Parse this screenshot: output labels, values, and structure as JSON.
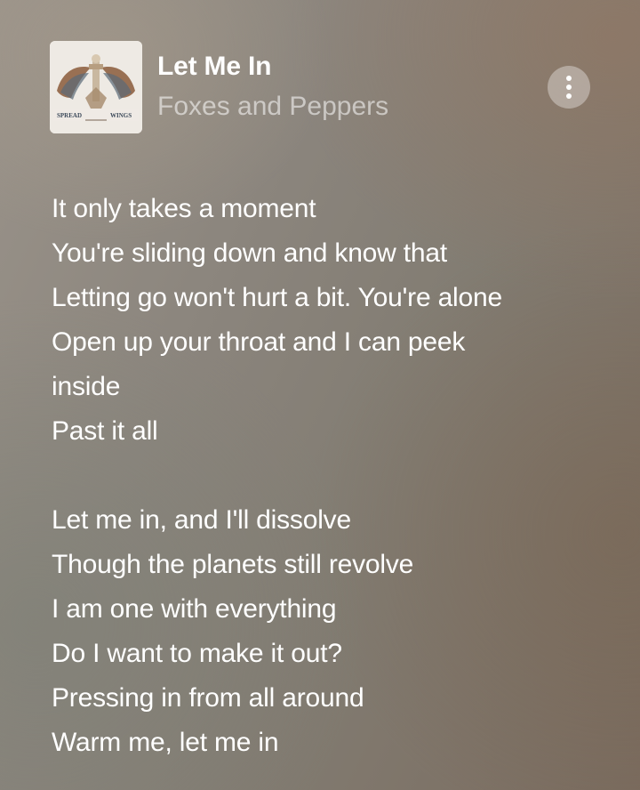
{
  "track": {
    "title": "Let Me In",
    "artist": "Foxes and Peppers",
    "album_art": {
      "icon": "album-cover-spread-the-wings",
      "text_left": "SPREAD",
      "text_right": "WINGS"
    }
  },
  "more_button": {
    "icon": "more-vertical-icon"
  },
  "lyrics": {
    "stanzas": [
      {
        "lines": [
          "It only takes a moment",
          "You're sliding down and know that",
          "Letting go won't hurt a bit. You're alone",
          "Open up your throat and I can peek",
          "inside",
          "Past it all"
        ]
      },
      {
        "lines": [
          "Let me in, and I'll dissolve",
          "Though the planets still revolve",
          "I am one with everything",
          "Do I want to make it out?",
          "Pressing in from all around",
          "Warm me, let me in"
        ]
      }
    ]
  },
  "colors": {
    "text_primary": "#ffffff",
    "text_secondary": "rgba(255,255,255,0.55)",
    "background_start": "#9a938a",
    "background_end": "#7a6b5e"
  }
}
